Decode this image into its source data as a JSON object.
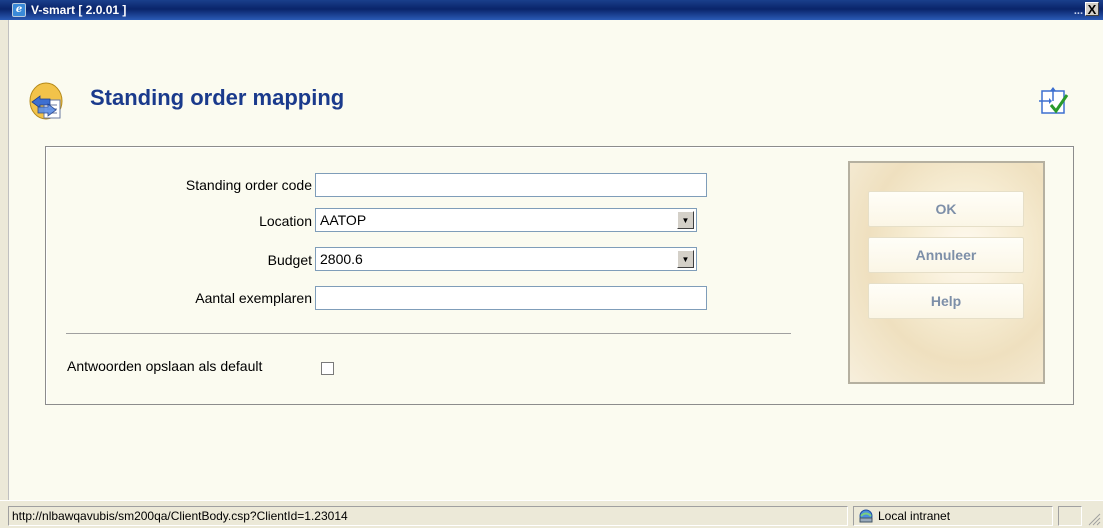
{
  "window": {
    "title": "V-smart [ 2.0.01 ]",
    "close_glyph": "X",
    "minimize_glyph": "...",
    "app_icon": "ie-icon"
  },
  "page": {
    "title": "Standing order mapping",
    "header_icon": "mapping-arrows-icon",
    "help_icon": "help-check-icon"
  },
  "form": {
    "standing_order_code": {
      "label": "Standing order code",
      "value": ""
    },
    "location": {
      "label": "Location",
      "value": "AATOP"
    },
    "budget": {
      "label": "Budget",
      "value": "2800.6"
    },
    "aantal": {
      "label": "Aantal exemplaren",
      "value": ""
    },
    "default_checkbox": {
      "label": "Antwoorden opslaan als default",
      "checked": false
    }
  },
  "buttons": {
    "ok": "OK",
    "cancel": "Annuleer",
    "help": "Help"
  },
  "statusbar": {
    "url": "http://nlbawqavubis/sm200qa/ClientBody.csp?ClientId=1.23014",
    "zone": "Local intranet"
  },
  "colors": {
    "title_blue": "#1a3a8c",
    "button_text": "#7d8fa8",
    "background": "#fbfbf0"
  }
}
